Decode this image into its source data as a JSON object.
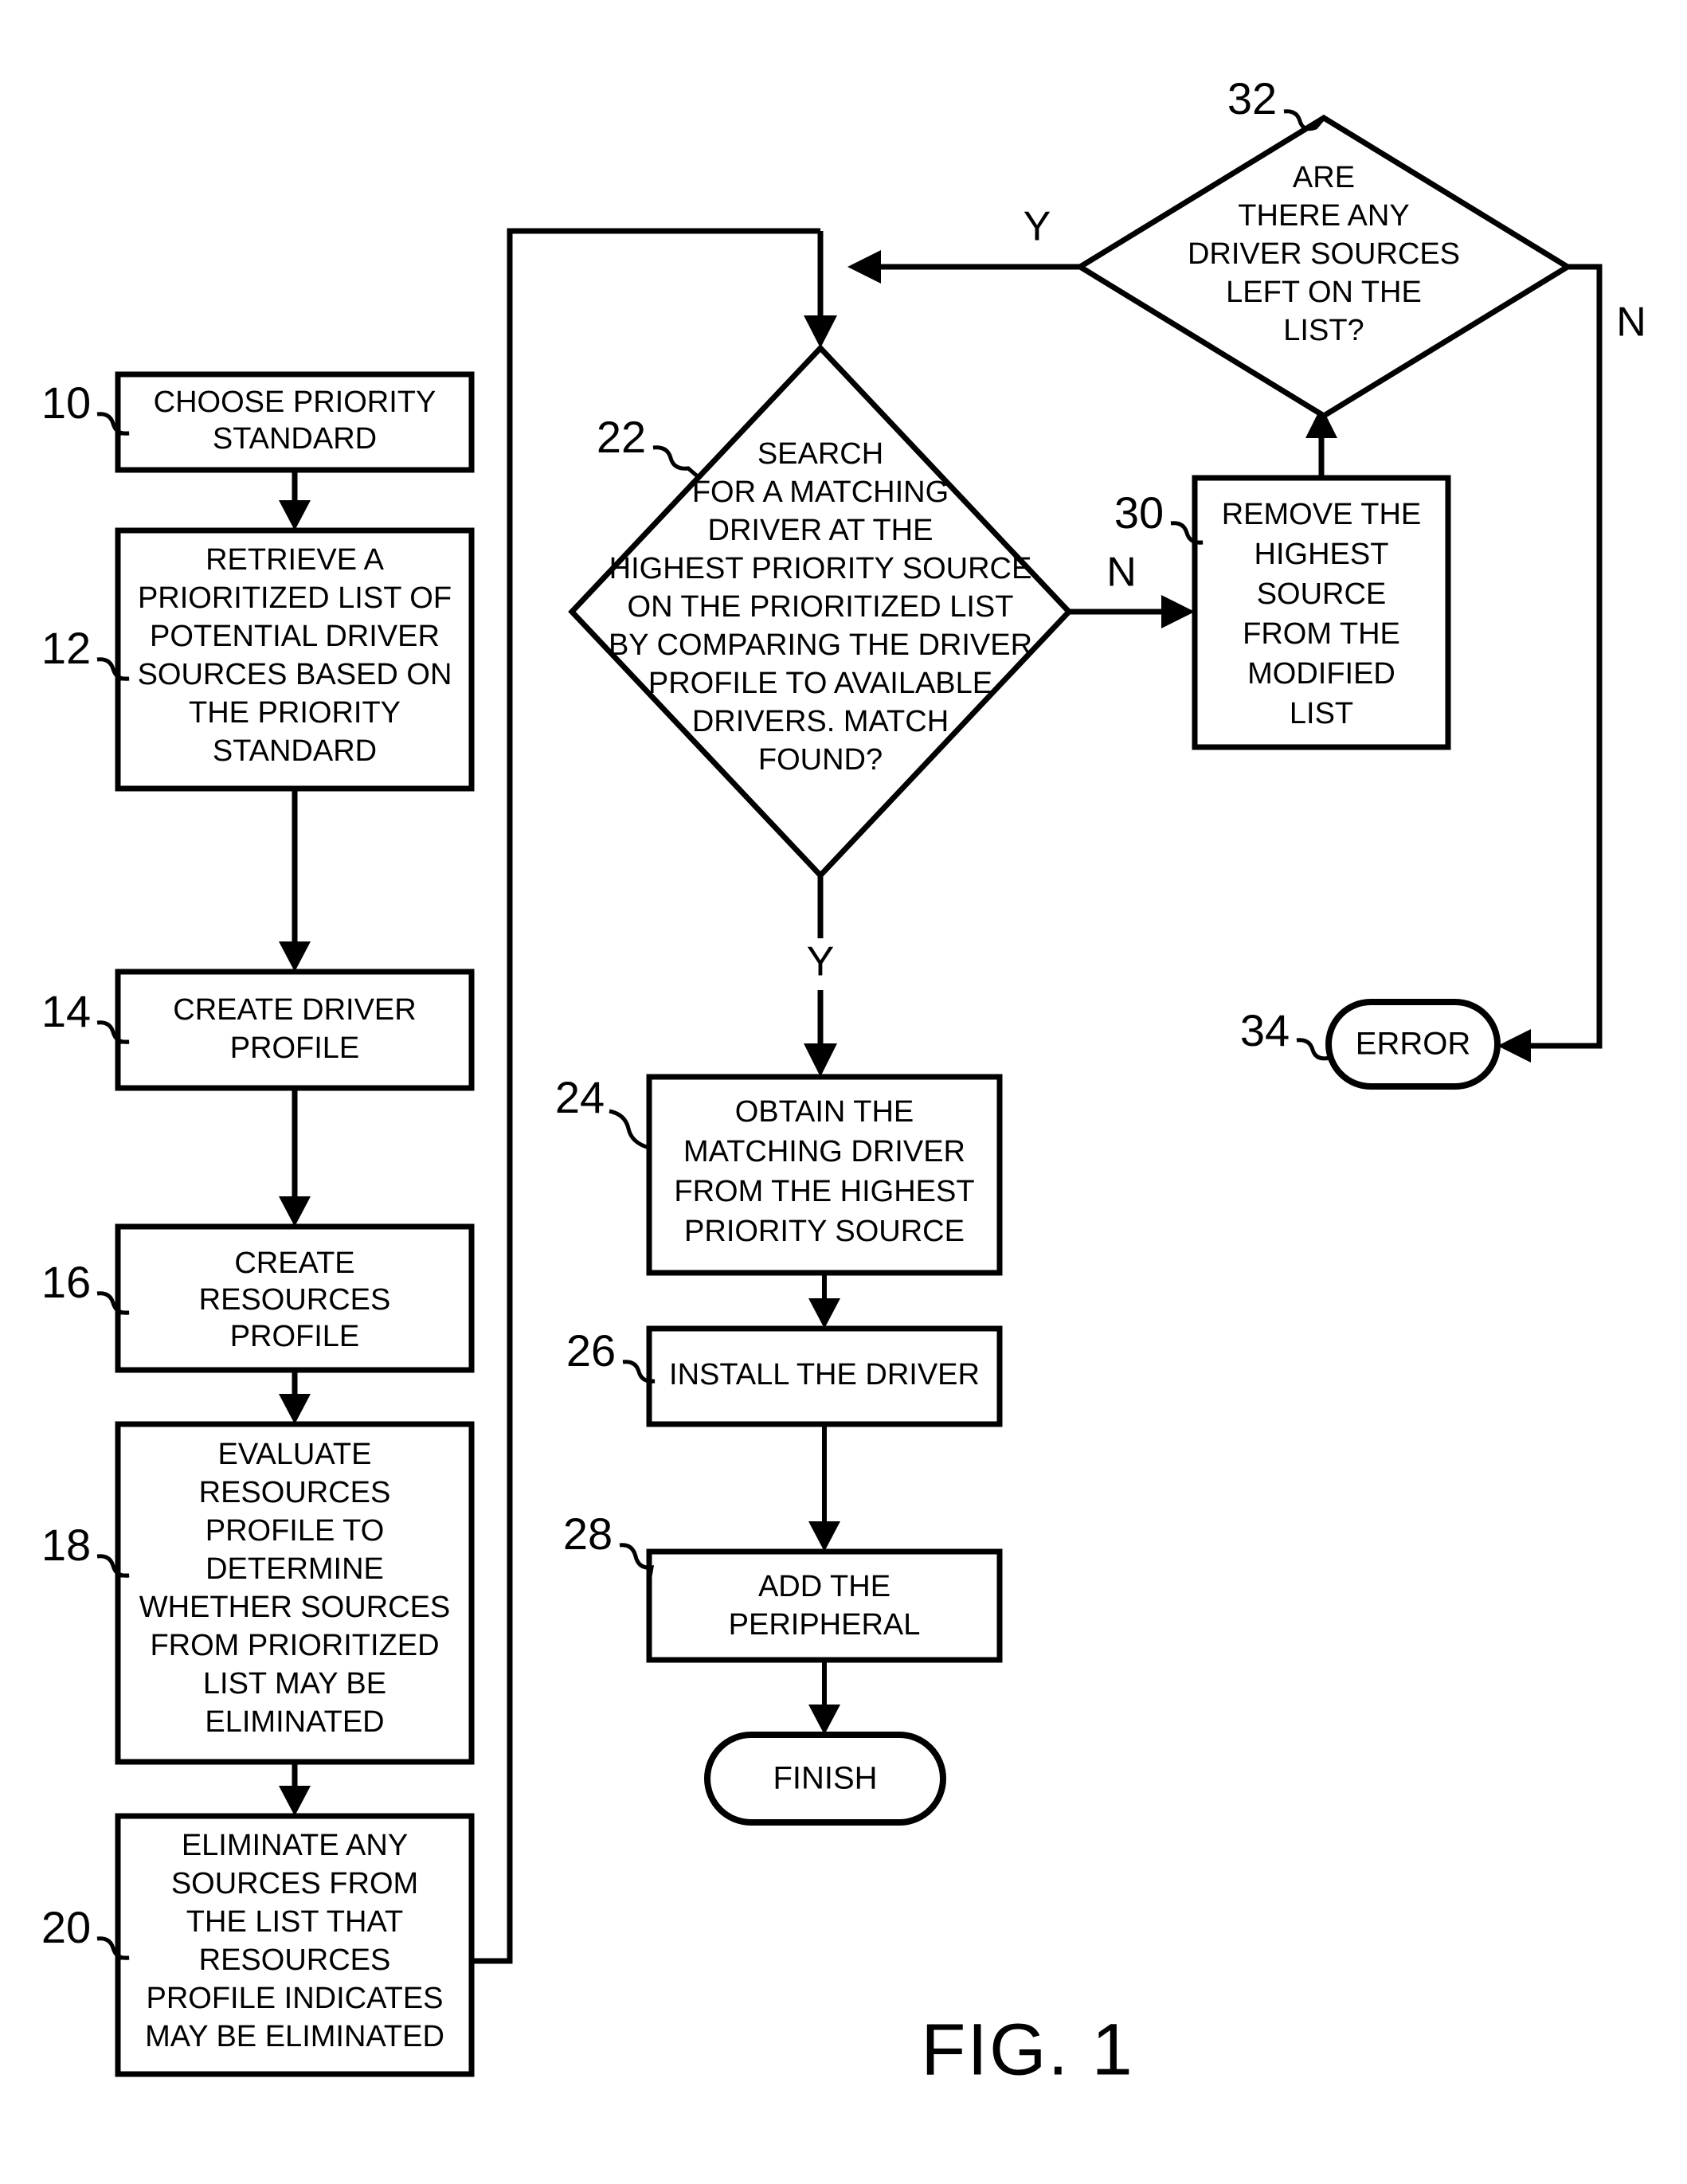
{
  "figure": {
    "caption": "FIG. 1",
    "title": "Driver installation flowchart"
  },
  "nodes": [
    {
      "id": "n10",
      "ref": "10",
      "type": "process",
      "lines": [
        "CHOOSE PRIORITY",
        "STANDARD"
      ]
    },
    {
      "id": "n12",
      "ref": "12",
      "type": "process",
      "lines": [
        "RETRIEVE A",
        "PRIORITIZED LIST OF",
        "POTENTIAL DRIVER",
        "SOURCES BASED ON",
        "THE PRIORITY",
        "STANDARD"
      ]
    },
    {
      "id": "n14",
      "ref": "14",
      "type": "process",
      "lines": [
        "CREATE DRIVER",
        "PROFILE"
      ]
    },
    {
      "id": "n16",
      "ref": "16",
      "type": "process",
      "lines": [
        "CREATE",
        "RESOURCES",
        "PROFILE"
      ]
    },
    {
      "id": "n18",
      "ref": "18",
      "type": "process",
      "lines": [
        "EVALUATE",
        "RESOURCES",
        "PROFILE TO",
        "DETERMINE",
        "WHETHER SOURCES",
        "FROM PRIORITIZED",
        "LIST MAY BE",
        "ELIMINATED"
      ]
    },
    {
      "id": "n20",
      "ref": "20",
      "type": "process",
      "lines": [
        "ELIMINATE ANY",
        "SOURCES FROM",
        "THE LIST THAT",
        "RESOURCES",
        "PROFILE INDICATES",
        "MAY BE ELIMINATED"
      ]
    },
    {
      "id": "n22",
      "ref": "22",
      "type": "decision",
      "lines": [
        "SEARCH",
        "FOR A MATCHING",
        "DRIVER AT THE",
        "HIGHEST PRIORITY SOURCE",
        "ON THE PRIORITIZED LIST",
        "BY COMPARING THE DRIVER",
        "PROFILE TO AVAILABLE",
        "DRIVERS. MATCH",
        "FOUND?"
      ]
    },
    {
      "id": "n24",
      "ref": "24",
      "type": "process",
      "lines": [
        "OBTAIN THE",
        "MATCHING DRIVER",
        "FROM THE HIGHEST",
        "PRIORITY SOURCE"
      ]
    },
    {
      "id": "n26",
      "ref": "26",
      "type": "process",
      "lines": [
        "INSTALL THE DRIVER"
      ]
    },
    {
      "id": "n28",
      "ref": "28",
      "type": "process",
      "lines": [
        "ADD THE",
        "PERIPHERAL"
      ]
    },
    {
      "id": "n30",
      "ref": "30",
      "type": "process",
      "lines": [
        "REMOVE THE",
        "HIGHEST",
        "SOURCE",
        "FROM THE",
        "MODIFIED",
        "LIST"
      ]
    },
    {
      "id": "n32",
      "ref": "32",
      "type": "decision",
      "lines": [
        "ARE",
        "THERE ANY",
        "DRIVER SOURCES",
        "LEFT ON THE",
        "LIST?"
      ]
    },
    {
      "id": "n34",
      "ref": "34",
      "type": "terminator",
      "lines": [
        "ERROR"
      ]
    },
    {
      "id": "nFinish",
      "ref": "",
      "type": "terminator",
      "lines": [
        "FINISH"
      ]
    }
  ],
  "branch_labels": {
    "d22_no": "N",
    "d22_yes": "Y",
    "d32_yes": "Y",
    "d32_no": "N"
  },
  "colors": {
    "stroke": "#000000",
    "fill": "#ffffff",
    "background": "#ffffff"
  }
}
